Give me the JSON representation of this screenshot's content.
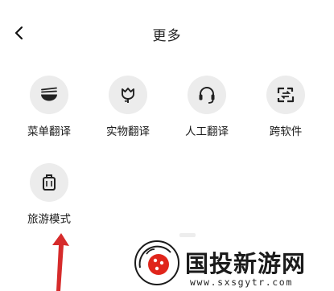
{
  "header": {
    "title": "更多",
    "back_icon": "chevron-left-icon"
  },
  "tools": [
    {
      "label": "菜单翻译",
      "icon": "bowl-icon"
    },
    {
      "label": "实物翻译",
      "icon": "tulip-icon"
    },
    {
      "label": "人工翻译",
      "icon": "headset-icon"
    },
    {
      "label": "跨软件",
      "icon": "swap-frame-icon"
    },
    {
      "label": "旅游模式",
      "icon": "suitcase-icon"
    }
  ],
  "watermark": {
    "site_name": "国投新游网",
    "url": "www.sxsgytr.com"
  },
  "colors": {
    "icon_bg": "#ececec",
    "arrow": "#d62b2b",
    "logo_red": "#e0251b"
  }
}
